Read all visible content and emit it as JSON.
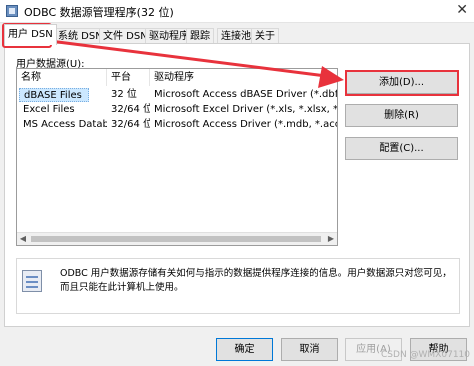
{
  "window": {
    "title": "ODBC 数据源管理程序(32 位)",
    "close_glyph": "✕"
  },
  "tabs": [
    {
      "label": "用户 DSN"
    },
    {
      "label": "系统 DSN"
    },
    {
      "label": "文件 DSN"
    },
    {
      "label": "驱动程序"
    },
    {
      "label": "跟踪"
    },
    {
      "label": "连接池"
    },
    {
      "label": "关于"
    }
  ],
  "user_dsn": {
    "list_label": "用户数据源(U):",
    "columns": [
      "名称",
      "平台",
      "驱动程序"
    ],
    "rows": [
      [
        "dBASE Files",
        "32 位",
        "Microsoft Access dBASE Driver (*.dbf, *.ndx, *"
      ],
      [
        "Excel Files",
        "32/64 位",
        "Microsoft Excel Driver (*.xls, *.xlsx, *.xlsm, *"
      ],
      [
        "MS Access Database",
        "32/64 位",
        "Microsoft Access Driver (*.mdb, *.accdb)"
      ]
    ],
    "buttons": {
      "add": "添加(D)...",
      "remove": "删除(R)",
      "configure": "配置(C)..."
    },
    "info_text": "ODBC 用户数据源存储有关如何与指示的数据提供程序连接的信息。用户数据源只对您可见，而且只能在此计算机上使用。"
  },
  "footer": {
    "ok": "确定",
    "cancel": "取消",
    "apply": "应用(A)",
    "help": "帮助"
  },
  "watermark": "CSDN @WMX07110",
  "colors": {
    "annotation": "#e8323c",
    "selection": "#cce8ff",
    "focus_border": "#0078d7"
  }
}
